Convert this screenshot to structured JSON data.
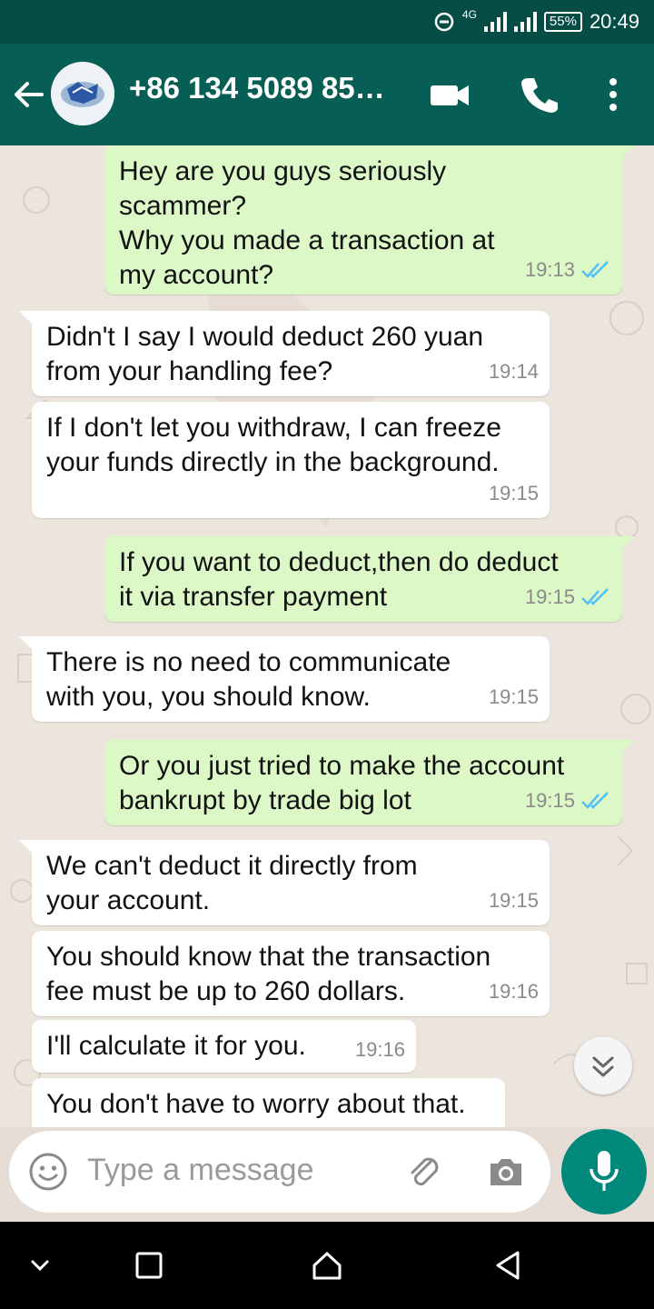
{
  "status_bar": {
    "network": "4G",
    "battery": "55%",
    "time": "20:49"
  },
  "header": {
    "contact": "+86 134 5089 85…"
  },
  "messages": [
    {
      "dir": "out",
      "lines": [
        "Hey are you guys seriously",
        "scammer?",
        "Why you made a transaction at",
        "my account?"
      ],
      "time": "19:13"
    },
    {
      "dir": "in",
      "lines": [
        "Didn't I say I would deduct 260 yuan",
        "from your handling fee?"
      ],
      "time": "19:14"
    },
    {
      "dir": "in",
      "lines": [
        "If I don't let you withdraw, I can freeze",
        "your funds directly in the background."
      ],
      "time": "19:15"
    },
    {
      "dir": "out",
      "lines": [
        "If you want to deduct,then do deduct",
        "it via transfer payment"
      ],
      "time": "19:15"
    },
    {
      "dir": "in",
      "lines": [
        "There is no need to communicate",
        "with you, you should know."
      ],
      "time": "19:15"
    },
    {
      "dir": "out",
      "lines": [
        "Or you just tried to make the account",
        "bankrupt by trade big lot"
      ],
      "time": "19:15"
    },
    {
      "dir": "in",
      "lines": [
        "We can't deduct it directly from",
        "your account."
      ],
      "time": "19:15"
    },
    {
      "dir": "in",
      "lines": [
        "You should know that the transaction",
        "fee must be up to 260 dollars."
      ],
      "time": "19:16"
    },
    {
      "dir": "in",
      "lines": [
        "I'll calculate it for you."
      ],
      "time": "19:16"
    },
    {
      "dir": "in",
      "lines": [
        "You don't have to worry about that."
      ],
      "time": ""
    }
  ],
  "composer": {
    "placeholder": "Type a message"
  },
  "colors": {
    "header": "#075e54",
    "status_bar": "#054d44",
    "outgoing": "#dcf8c6",
    "incoming": "#ffffff",
    "fab": "#00897b",
    "ticks": "#4fc3f7"
  },
  "icons": [
    "back-arrow-icon",
    "video-call-icon",
    "phone-icon",
    "more-vert-icon",
    "emoji-icon",
    "attach-icon",
    "camera-icon",
    "mic-icon",
    "scroll-down-icon",
    "nav-back-icon",
    "nav-home-icon",
    "nav-recents-icon",
    "nav-collapse-icon"
  ]
}
